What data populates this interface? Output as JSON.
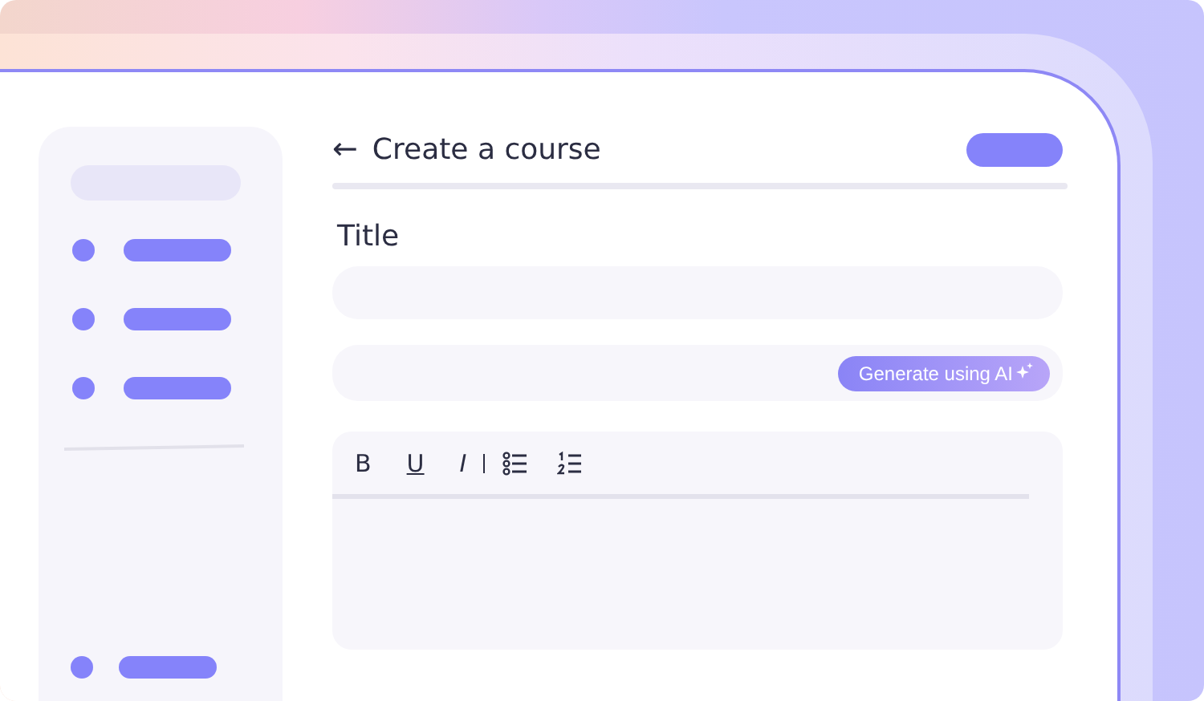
{
  "header": {
    "back": "←",
    "title": "Create a course"
  },
  "form": {
    "title_label": "Title",
    "generate_button": "Generate using AI"
  },
  "editor": {
    "toolbar": [
      {
        "kind": "bold",
        "label": "B"
      },
      {
        "kind": "underline",
        "label": "U"
      },
      {
        "kind": "italic",
        "label": "I"
      }
    ]
  }
}
